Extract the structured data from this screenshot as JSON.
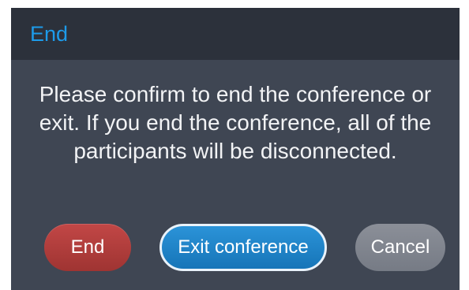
{
  "dialog": {
    "title": "End",
    "message": "Please confirm to end the conference or exit. If you end the conference, all of the participants will be disconnected.",
    "buttons": {
      "end_label": "End",
      "exit_label": "Exit conference",
      "cancel_label": "Cancel"
    }
  },
  "colors": {
    "title_accent": "#1d9bea",
    "dialog_background": "#3f4653",
    "header_background": "#2c313b",
    "end_button": "#b03e3c",
    "exit_button": "#1f84c8",
    "cancel_button": "#80858f"
  }
}
